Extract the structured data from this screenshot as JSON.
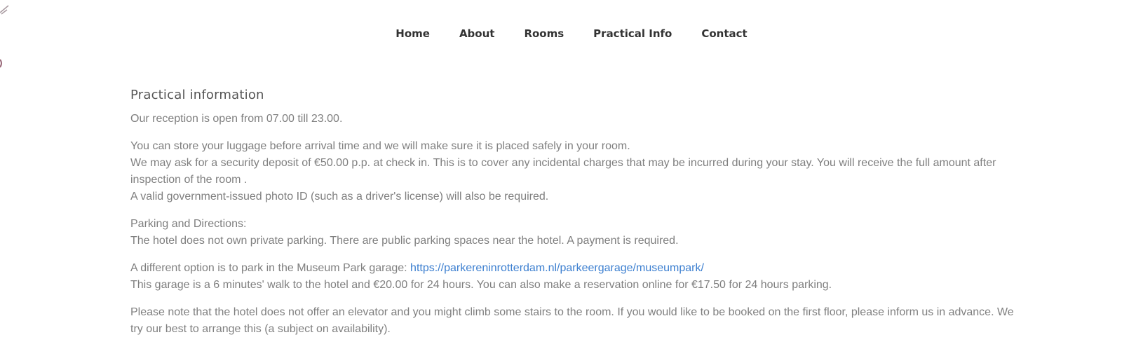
{
  "nav": {
    "items": [
      "Home",
      "About",
      "Rooms",
      "Practical Info",
      "Contact"
    ]
  },
  "main": {
    "title": "Practical information",
    "reception": "Our reception is open from 07.00 till 23.00.",
    "luggage": {
      "line1": "You can store your luggage before arrival time and we will make sure it is placed safely in your room.",
      "line2": "We may ask for a security deposit of €50.00 p.p. at check in. This is to cover any incidental charges that may be incurred during your stay. You will receive the full amount after inspection of the room .",
      "line3": "A valid government-issued photo ID (such as a driver's license) will also be required."
    },
    "parking": {
      "heading": "Parking and Directions:",
      "text": "The hotel does not own private parking. There are public parking spaces near the hotel. A payment is required."
    },
    "garage": {
      "intro": "A different option is to park in the Museum Park garage: ",
      "link": "https://parkereninrotterdam.nl/parkeergarage/museumpark/",
      "details": "This garage is a 6 minutes' walk to the hotel and €20.00 for 24 hours. You can also make a reservation online for €17.50 for 24 hours parking."
    },
    "elevator": "Please note that the hotel does not offer an elevator and you might climb some stairs to the room. If you would like to be booked on the first floor, please inform us in advance. We try our best to arrange this (a subject on availability)."
  },
  "colors": {
    "nav_text": "#333333",
    "body_text": "#7f7f7f",
    "title_text": "#555555",
    "link": "#3c7fd0"
  }
}
